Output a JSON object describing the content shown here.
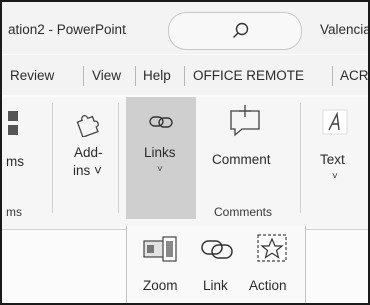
{
  "window": {
    "title_fragment": "ation2 - PowerPoint",
    "user_fragment": "Valencia N"
  },
  "menu": {
    "tabs": [
      "Review",
      "View",
      "Help",
      "OFFICE REMOTE",
      "ACR"
    ]
  },
  "ribbon": {
    "left_partial_label": "ms",
    "left_group_partial": "ms",
    "addins": {
      "label_line1": "Add-",
      "label_line2": "ins ˅"
    },
    "links": {
      "label": "Links",
      "chevron": "˅"
    },
    "comment": {
      "label": "Comment"
    },
    "comments_group_label": "Comments",
    "text": {
      "label": "Text",
      "chevron": "˅"
    }
  },
  "links_dropdown": {
    "items": [
      {
        "label": "Zoom",
        "icon": "zoom-icon"
      },
      {
        "label": "Link",
        "icon": "link-icon"
      },
      {
        "label": "Action",
        "icon": "action-star-icon"
      }
    ]
  },
  "colors": {
    "titlebar_bg": "#f3f3f3",
    "ribbon_bg": "#f6f6f6",
    "links_selected_bg": "#cfcfcf",
    "frame_border": "#1a1a1a"
  }
}
